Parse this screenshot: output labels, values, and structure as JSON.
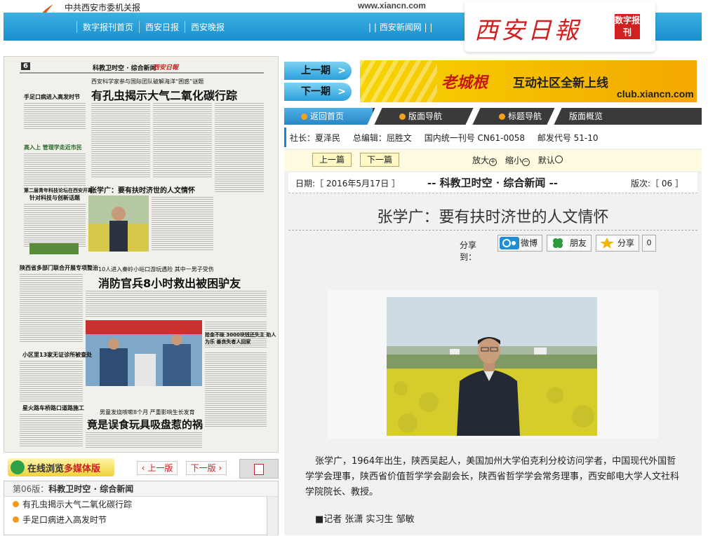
{
  "site": {
    "org_name": "中共西安市委机关报",
    "domain": "www.xiancn.com",
    "masthead_title": "西安日報",
    "masthead_badge": "数字报刊"
  },
  "topnav": {
    "items": [
      "数字报刊首页",
      "西安日报",
      "西安晚报"
    ],
    "xian_news": "| | 西安新闻网 | |"
  },
  "newspaper_page": {
    "page_no": "6",
    "section": "科教卫时空 · 综合新闻",
    "headline_main": "有孔虫揭示大气二氧化碳行踪",
    "headline_kicker": "西安科学家参与国际团队破解海洋“困惑”谜题",
    "headline_zxg": "张学广：要有扶时济世的人文情怀",
    "headline_fire": "消防官兵8小时救出被困驴友",
    "headline_fire_kicker": "10人进入秦岭小峪口游玩遇险 其中一男子受伤",
    "headline_toy": "竟是误食玩具吸盘惹的祸",
    "headline_toy_kicker": "男童发烧咳嗽8个月 严重影响生长发育",
    "headline_hfm": "手足口病进入高发时节",
    "headline_left1": "第二届青年科技论坛在西安开幕",
    "headline_left2": "针对科技与创新话题",
    "headline_gg": "高入上 管理学走近市民",
    "headline_cb": "陕西省多部门联合开展专项整治",
    "headline_zjfz": "拾金不昧 3000块钱还失主 助人为乐 善良失者人回家",
    "headline_xq": "小区里13家无证诊所被查处",
    "headline_xzzr": "星火路车桥路口道路施工"
  },
  "multimedia": {
    "label_a": "在线浏览",
    "label_b": "多媒体版"
  },
  "pager": {
    "prev_label": "上一版",
    "next_label": "下一版"
  },
  "toc": {
    "page_label": "第06版：",
    "section": "科教卫时空 · 综合新闻",
    "items": [
      "有孔虫揭示大气二氧化碳行踪",
      "手足口病进入高发时节"
    ]
  },
  "issue_nav": {
    "prev_issue": "上一期",
    "next_issue": "下一期"
  },
  "banner": {
    "brand": "老城根",
    "slogan": "互动社区全新上线",
    "url": "club.xiancn.com"
  },
  "tabs": [
    "返回首页",
    "版面导航",
    "标题导航",
    "版面概览"
  ],
  "meta": {
    "president": "社长：夏泽民",
    "editor": "总编辑：屈胜文",
    "issn": "国内统一刊号 CN61-0058",
    "postal": "邮发代号 51-10"
  },
  "article_nav": {
    "prev_article": "上一篇",
    "next_article": "下一篇",
    "zoom_in": "放大",
    "zoom_out": "缩小",
    "default": "默认"
  },
  "info": {
    "date": "日期:［ 2016年5月17日 ］",
    "section": "-- 科教卫时空 · 综合新闻 --",
    "page": "版次:［ 06 ］"
  },
  "article": {
    "title": "张学广：要有扶时济世的人文情怀",
    "body": "张学广，1964年出生，陕西吴起人，美国加州大学伯克利分校访问学者，中国现代外国哲学学会理事，陕西省价值哲学学会副会长，陕西省哲学学会常务理事，西安邮电大学人文社科学院院长、教授。",
    "byline": "■记者 张潇 实习生 邹敏"
  },
  "share": {
    "label": "分享到：",
    "weibo": "微博",
    "pengyou": "朋友",
    "fenxiang": "分享",
    "count": "0"
  },
  "colors": {
    "nav_blue": "#1b8fcc",
    "brand_red": "#d21f1f",
    "tab_dark": "#3a3a3a",
    "banner_yellow": "#f6d400"
  }
}
